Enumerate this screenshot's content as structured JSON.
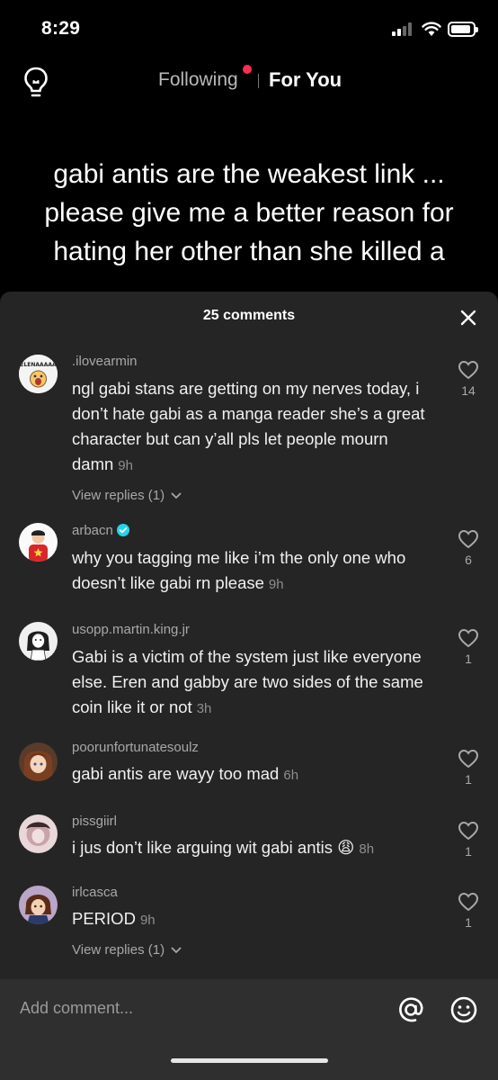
{
  "status_bar": {
    "time": "8:29",
    "battery_level": 0.9
  },
  "nav": {
    "following_label": "Following",
    "for_you_label": "For You",
    "live_dot_color": "#fe2c55"
  },
  "video": {
    "caption": "gabi antis are the weakest link ... please give me a better reason for hating her other than she killed a"
  },
  "sheet": {
    "count_label": "25 comments",
    "comments": [
      {
        "username": ".ilovearmin",
        "avatar_text": "ELENAAAAA",
        "text": "ngl gabi stans are getting on my nerves today, i don’t hate gabi as a manga reader she’s a great character but can y’all pls let people mourn damn",
        "time": "9h",
        "likes": "14",
        "replies": "View replies (1)"
      },
      {
        "username": "arbacn",
        "verified": true,
        "text": "why you tagging me like i’m the only one who doesn’t like gabi rn please",
        "time": "9h",
        "likes": "6"
      },
      {
        "username": "usopp.martin.king.jr",
        "text": "Gabi is a victim of the system just like everyone else. Eren and gabby are two sides of the same coin like it or not",
        "time": "3h",
        "likes": "1"
      },
      {
        "username": "poorunfortunatesoulz",
        "text": "gabi antis are wayy too mad",
        "time": "6h",
        "likes": "1"
      },
      {
        "username": "pissgiirl",
        "text": "i jus don’t like arguing wit gabi antis 😩",
        "time": "8h",
        "likes": "1"
      },
      {
        "username": "irlcasca",
        "text": "PERIOD",
        "time": "9h",
        "likes": "1",
        "replies": "View replies (1)"
      }
    ]
  },
  "input": {
    "placeholder": "Add comment..."
  },
  "icons": {
    "bulb": "lightbulb-icon",
    "close": "close-icon",
    "heart": "heart-icon",
    "at": "at-mention-icon",
    "emoji": "emoji-icon",
    "chevron": "chevron-down-icon"
  }
}
